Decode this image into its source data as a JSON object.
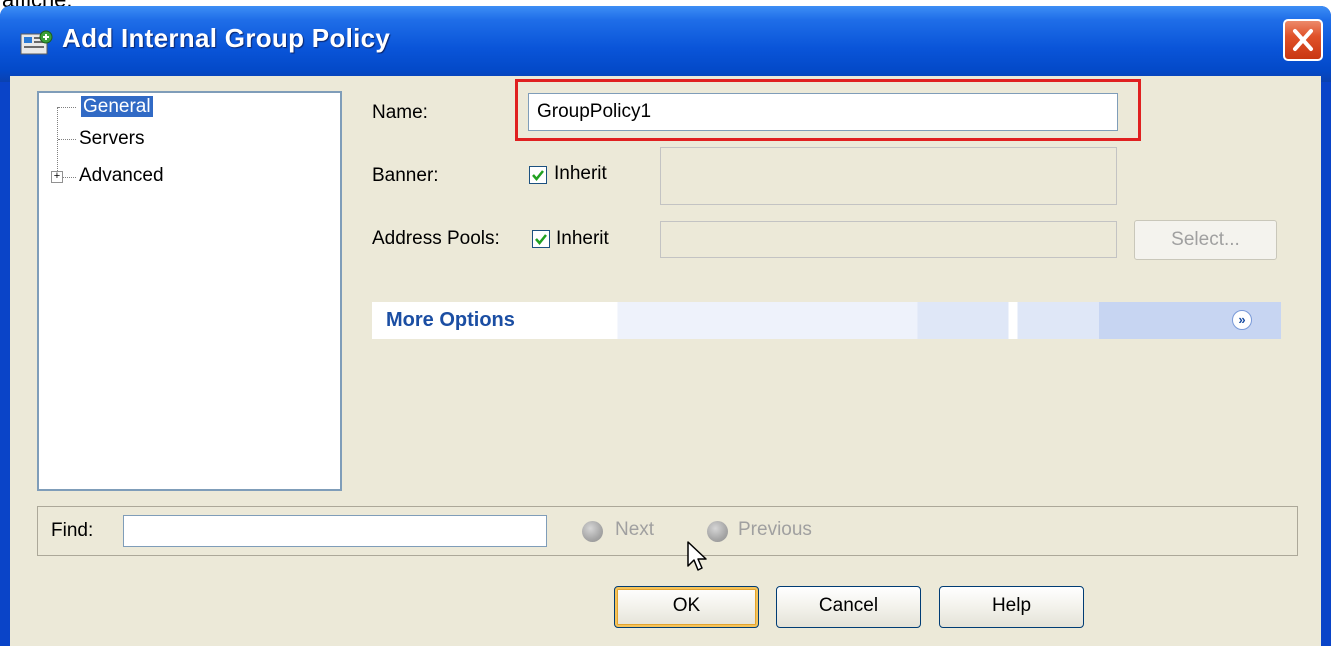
{
  "caption_top": "affiche:",
  "window": {
    "title": "Add Internal Group Policy",
    "icon": "group-policy-icon",
    "close_icon": "close-icon"
  },
  "tree": {
    "items": [
      {
        "label": "General",
        "selected": true
      },
      {
        "label": "Servers",
        "selected": false
      },
      {
        "label": "Advanced",
        "selected": false,
        "expander": "+"
      }
    ]
  },
  "form": {
    "name_label": "Name:",
    "name_value": "GroupPolicy1",
    "banner_label": "Banner:",
    "banner_inherit_label": "Inherit",
    "banner_inherit_checked": true,
    "address_pools_label": "Address Pools:",
    "address_pools_inherit_label": "Inherit",
    "address_pools_inherit_checked": true,
    "select_button": "Select..."
  },
  "more_options": {
    "label": "More Options",
    "icon": "chevron-double-down-icon"
  },
  "find": {
    "label": "Find:",
    "value": "",
    "next_label": "Next",
    "previous_label": "Previous"
  },
  "buttons": {
    "ok": "OK",
    "cancel": "Cancel",
    "help": "Help"
  },
  "colors": {
    "title_bar": "#0a55d9",
    "highlight_border": "#e02020",
    "selection": "#316ac5",
    "more_options_text": "#1b4ea3"
  }
}
